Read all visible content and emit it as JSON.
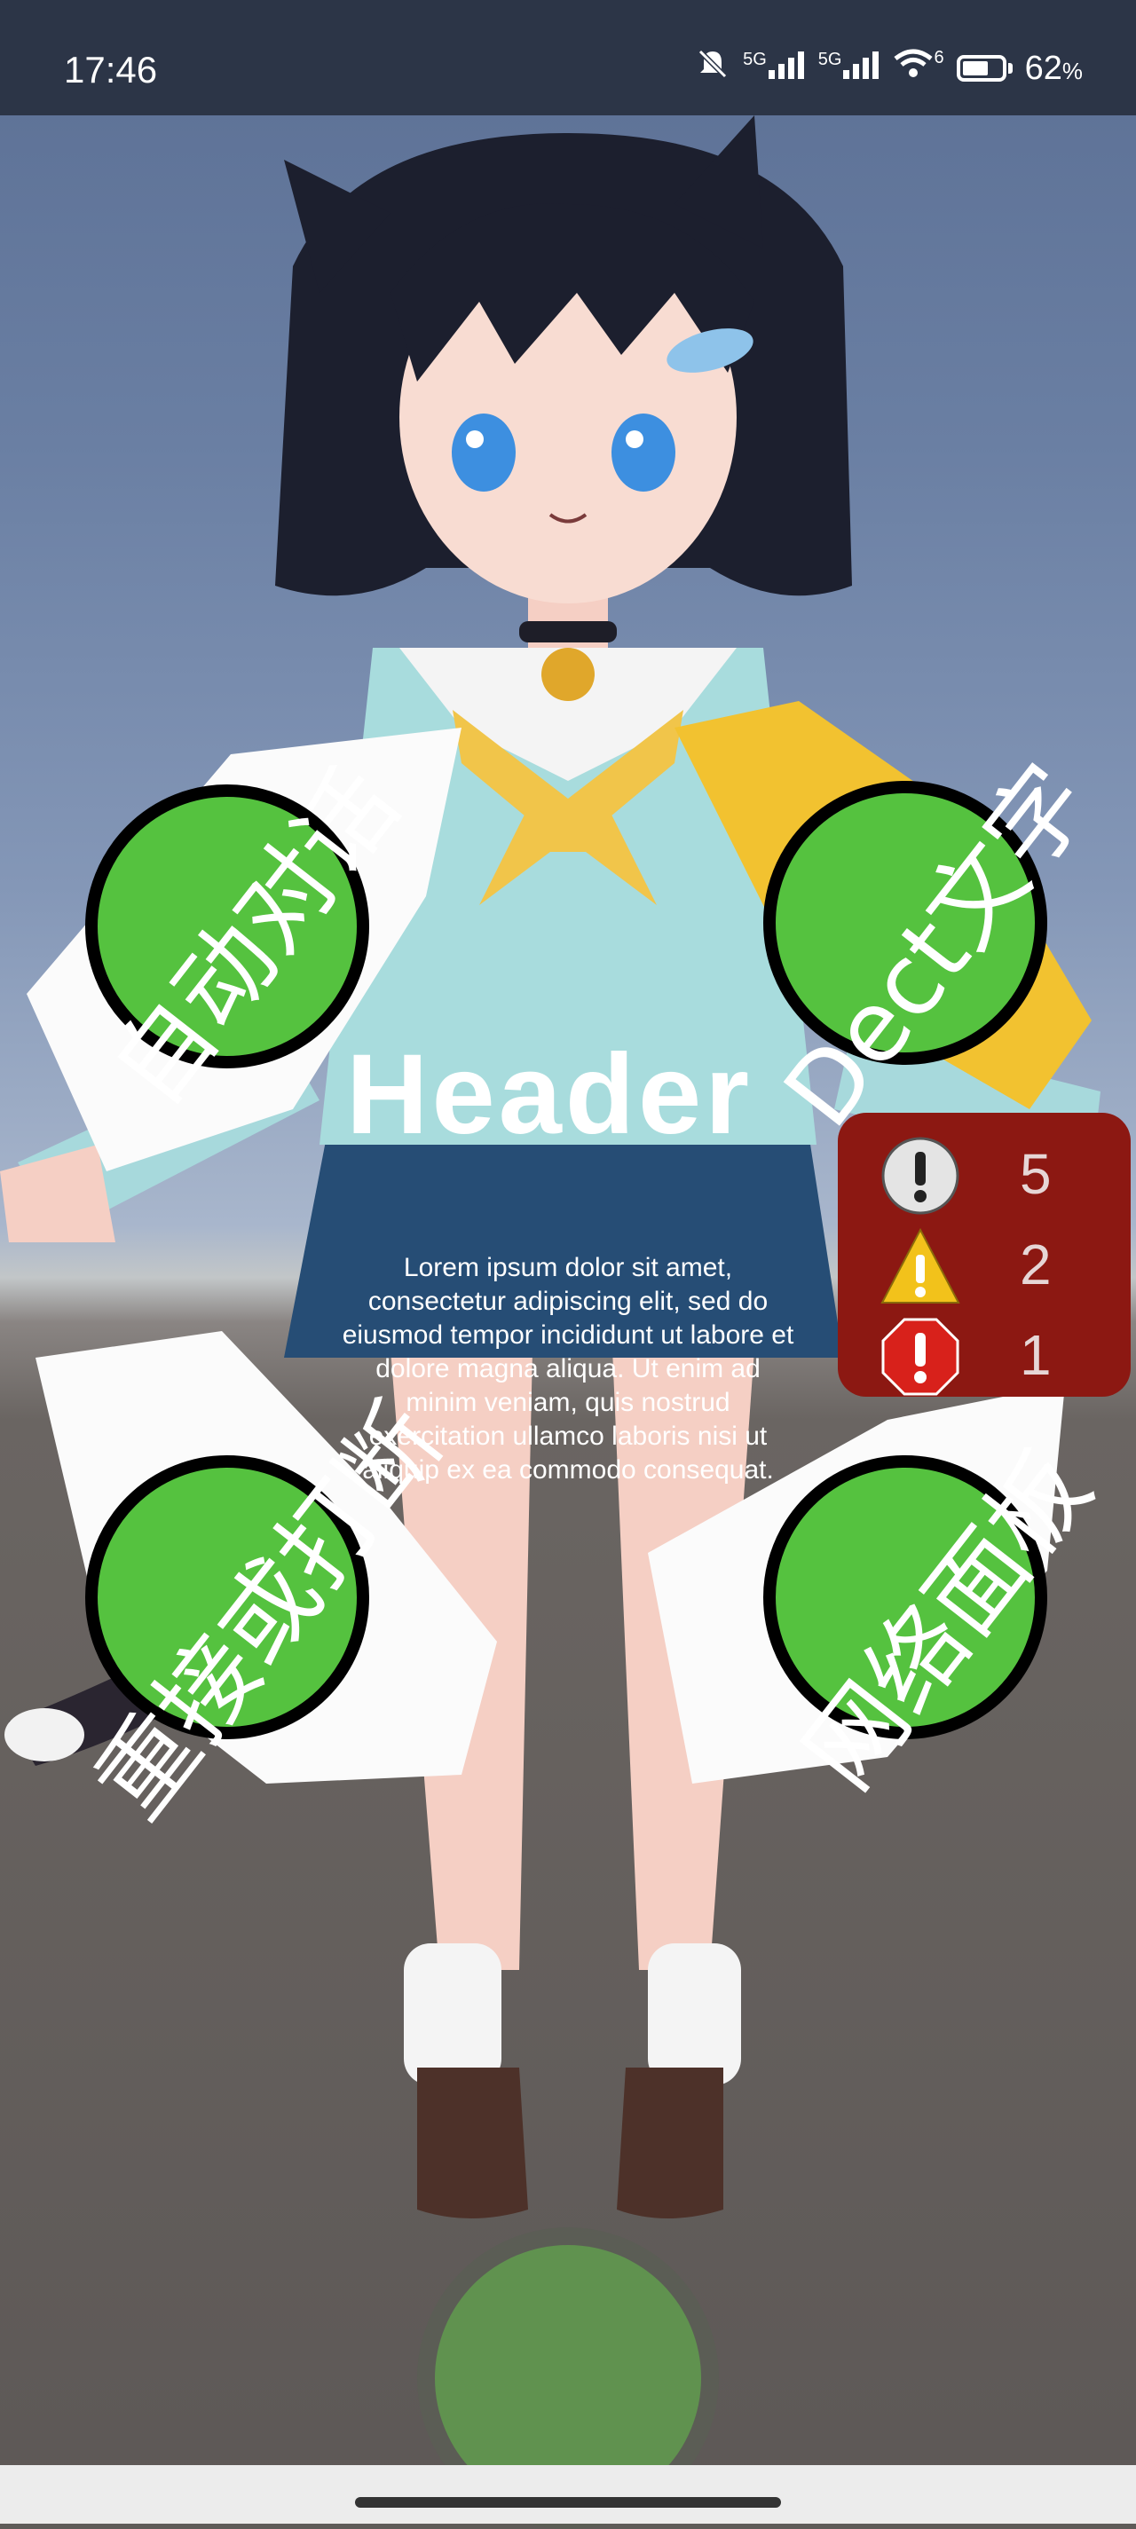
{
  "status_bar": {
    "time": "17:46",
    "signal_1_label": "5G",
    "signal_2_label": "5G",
    "wifi_badge": "6",
    "battery_percent": "62",
    "battery_unit": "%",
    "icons": [
      "mute-icon",
      "signal-icon",
      "signal-icon",
      "wifi-icon",
      "battery-icon"
    ]
  },
  "buttons": {
    "top_left_label": "自动对话",
    "top_right_label": "Dect文字",
    "bottom_left_label": "重接或打断",
    "bottom_right_label": "网络面板"
  },
  "header": {
    "title": "Header"
  },
  "body_text": "Lorem ipsum dolor sit amet, consectetur adipiscing elit, sed do eiusmod tempor incididunt ut labore et dolore magna aliqua. Ut enim ad minim veniam, quis nostrud exercitation ullamco laboris nisi ut aliquip ex ea commodo consequat.",
  "log_counter": {
    "info_count": "5",
    "warning_count": "2",
    "error_count": "1",
    "colors": {
      "panel": "#8c1812",
      "warning": "#f2c21b",
      "error": "#d8211b"
    }
  },
  "colors": {
    "button_green": "#55c23f",
    "mic_green": "#60924f"
  }
}
